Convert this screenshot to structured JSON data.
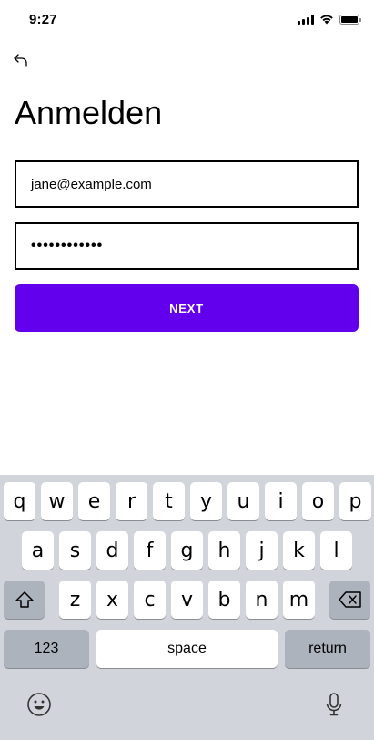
{
  "status_bar": {
    "time": "9:27"
  },
  "page": {
    "title": "Anmelden"
  },
  "form": {
    "email_value": "jane@example.com",
    "password_value": "••••••••••••",
    "next_label": "NEXT"
  },
  "keyboard": {
    "row1": [
      "q",
      "w",
      "e",
      "r",
      "t",
      "y",
      "u",
      "i",
      "o",
      "p"
    ],
    "row2": [
      "a",
      "s",
      "d",
      "f",
      "g",
      "h",
      "j",
      "k",
      "l"
    ],
    "row3": [
      "z",
      "x",
      "c",
      "v",
      "b",
      "n",
      "m"
    ],
    "numbers_label": "123",
    "space_label": "space",
    "return_label": "return"
  },
  "colors": {
    "accent": "#6200ee",
    "keyboard_bg": "#d1d5db",
    "dark_key": "#adb3bc"
  },
  "icons": [
    "back-arrow-icon",
    "signal-icon",
    "wifi-icon",
    "battery-icon",
    "shift-icon",
    "backspace-icon",
    "emoji-icon",
    "microphone-icon"
  ]
}
